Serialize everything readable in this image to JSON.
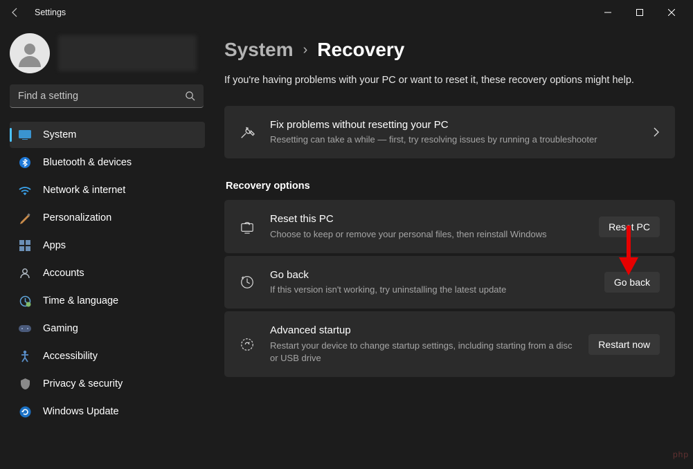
{
  "window": {
    "title": "Settings"
  },
  "search": {
    "placeholder": "Find a setting"
  },
  "nav": {
    "items": [
      {
        "label": "System"
      },
      {
        "label": "Bluetooth & devices"
      },
      {
        "label": "Network & internet"
      },
      {
        "label": "Personalization"
      },
      {
        "label": "Apps"
      },
      {
        "label": "Accounts"
      },
      {
        "label": "Time & language"
      },
      {
        "label": "Gaming"
      },
      {
        "label": "Accessibility"
      },
      {
        "label": "Privacy & security"
      },
      {
        "label": "Windows Update"
      }
    ]
  },
  "breadcrumb": {
    "parent": "System",
    "current": "Recovery"
  },
  "intro": "If you're having problems with your PC or want to reset it, these recovery options might help.",
  "fix": {
    "title": "Fix problems without resetting your PC",
    "sub": "Resetting can take a while — first, try resolving issues by running a troubleshooter"
  },
  "section": "Recovery options",
  "reset": {
    "title": "Reset this PC",
    "sub": "Choose to keep or remove your personal files, then reinstall Windows",
    "button": "Reset PC"
  },
  "goback": {
    "title": "Go back",
    "sub": "If this version isn't working, try uninstalling the latest update",
    "button": "Go back"
  },
  "advanced": {
    "title": "Advanced startup",
    "sub": "Restart your device to change startup settings, including starting from a disc or USB drive",
    "button": "Restart now"
  },
  "watermark": "php"
}
